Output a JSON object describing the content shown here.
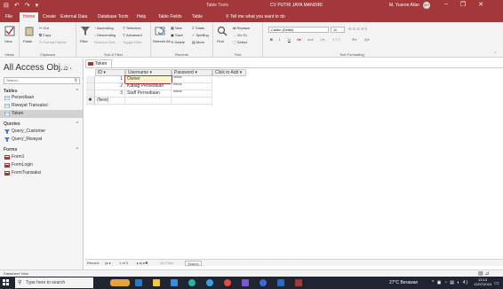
{
  "titlebar": {
    "quick_access": [
      "⊟",
      "↶",
      "↷",
      "▾"
    ],
    "context_label": "Table Tools",
    "window_title": "CV PUTRI JAYA MANDIRI",
    "user_name": "M. Yusron Afan",
    "user_initials": "MY",
    "controls": [
      "–",
      "❐",
      "✕"
    ]
  },
  "tabs": {
    "items": [
      "File",
      "Home",
      "Create",
      "External Data",
      "Database Tools",
      "Help",
      "Table Fields",
      "Table"
    ],
    "active": "Home",
    "tell_me": "Tell me what you want to do"
  },
  "ribbon": {
    "views": {
      "label": "View",
      "group": "Views"
    },
    "clipboard": {
      "paste": "Paste",
      "cut": "Cut",
      "copy": "Copy",
      "format_painter": "Format Painter",
      "group": "Clipboard"
    },
    "sort_filter": {
      "filter": "Filter",
      "ascending": "Ascending",
      "descending": "Descending",
      "remove_sort": "Remove Sort",
      "selection": "Selection",
      "advanced": "Advanced",
      "toggle_filter": "Toggle Filter",
      "group": "Sort & Filter"
    },
    "records": {
      "refresh": "Refresh All",
      "new": "New",
      "save": "Save",
      "delete": "Delete",
      "totals": "Totals",
      "spelling": "Spelling",
      "more": "More",
      "group": "Records"
    },
    "find": {
      "find": "Find",
      "replace": "Replace",
      "goto": "Go To",
      "select": "Select",
      "group": "Find"
    },
    "text_formatting": {
      "font": "Calibri (Detail)",
      "size": "11",
      "bold": "B",
      "italic": "I",
      "underline": "U",
      "group": "Text Formatting"
    }
  },
  "nav": {
    "title": "All Access Obj...",
    "search_placeholder": "Search...",
    "groups": [
      {
        "label": "Tables",
        "items": [
          "Persediaan",
          "Riwayat Transaksi",
          "Token"
        ]
      },
      {
        "label": "Queries",
        "items": [
          "Query_Customer",
          "Query_Riwayat"
        ]
      },
      {
        "label": "Forms",
        "items": [
          "Form1",
          "FormLogin",
          "FormTransaksi"
        ]
      }
    ],
    "selected": "Token"
  },
  "document": {
    "tab_label": "Token",
    "columns": [
      "ID",
      "Username",
      "Password",
      "Click to Add"
    ],
    "rows": [
      {
        "id": "1",
        "username": "Owner",
        "password": "*****"
      },
      {
        "id": "2",
        "username": "Kabag Persediaan",
        "password": "*****"
      },
      {
        "id": "3",
        "username": "Staff Persediaan",
        "password": "*****"
      }
    ],
    "new_row_label": "(New)",
    "new_row_marker": "✱"
  },
  "record_nav": {
    "label": "Record:",
    "position": "1 of 3",
    "filter_state": "No Filter",
    "search": "Search"
  },
  "status": {
    "view": "Datasheet View"
  },
  "taskbar": {
    "search_placeholder": "Type here to search",
    "weather": "27°C Berawan",
    "tray": "^ ▣ ◔ ▤ ◐ 4)",
    "time": "13:13",
    "date": "12/07/2024"
  }
}
